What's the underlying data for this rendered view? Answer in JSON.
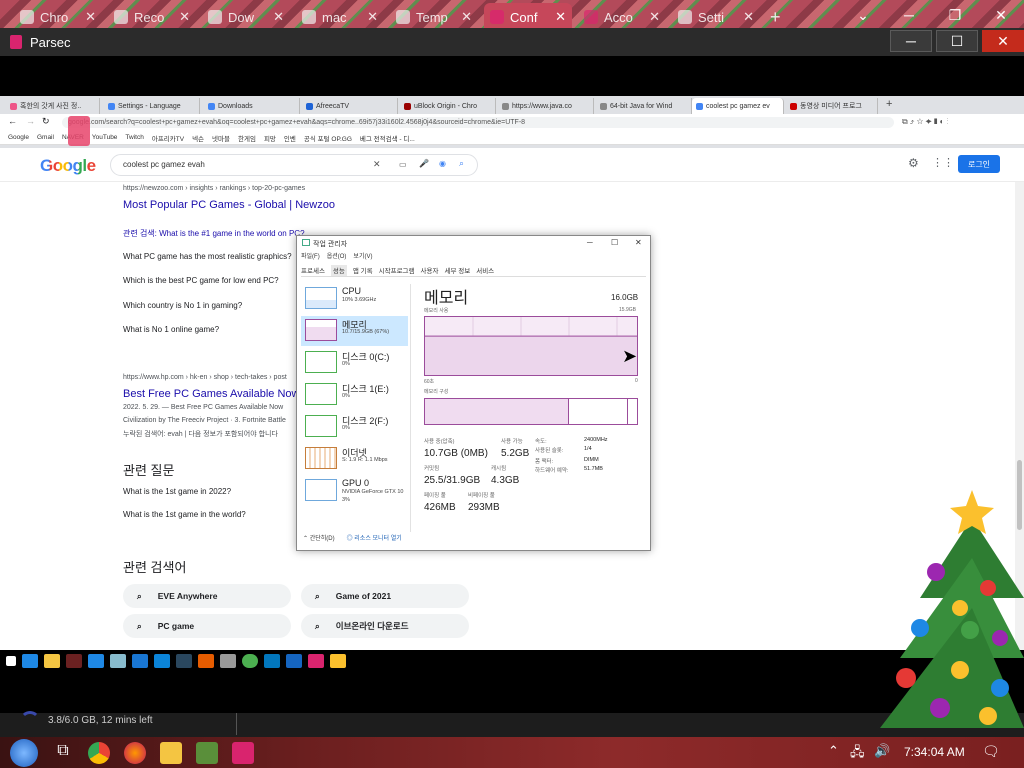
{
  "outer_tabs": [
    {
      "label": "Chro",
      "icon": "chrome-icon"
    },
    {
      "label": "Reco",
      "icon": "google-icon"
    },
    {
      "label": "Dow",
      "icon": "download-icon"
    },
    {
      "label": "mac",
      "icon": "bank-icon"
    },
    {
      "label": "Temp",
      "icon": "page-icon"
    },
    {
      "label": "Conf",
      "icon": "parsec-icon"
    },
    {
      "label": "Acco",
      "icon": "parsec-icon"
    },
    {
      "label": "Setti",
      "icon": "gear-icon"
    }
  ],
  "parsec": {
    "title": "Parsec"
  },
  "inner_tabs": [
    "혹한의 갓게 사진 정..",
    "Settings - Language",
    "Downloads",
    "AfreecaTV",
    "uBlock Origin - Chro",
    "https://www.java.co",
    "64-bit Java for Wind",
    "coolest pc gamez ev",
    "동영상 미디어 프로그"
  ],
  "url": "google.com/search?q=coolest+pc+gamez+evah&oq=coolest+pc+gamez+evah&aqs=chrome..69i57j33i160l2.4568j0j4&sourceid=chrome&ie=UTF-8",
  "bookmarks": [
    "Google",
    "Gmail",
    "NAVER",
    "YouTube",
    "Twitch",
    "아프리카TV",
    "넥슨",
    "넷마블",
    "한게임",
    "피망",
    "인벤",
    "공식 포털 OP.GG",
    "베그 전적검색 - 디..."
  ],
  "search": {
    "logo": "Google",
    "query": "coolest pc gamez evah",
    "login": "로그인"
  },
  "results": {
    "url1": "https://newzoo.com › insights › rankings › top-20-pc-games",
    "title1": "Most Popular PC Games - Global | Newzoo",
    "related": "관련 검색: What is the #1 game in the world on PC?",
    "q1": "What PC game has the most realistic graphics?",
    "q2": "Which is the best PC game for low end PC?",
    "q3": "Which country is No 1 in gaming?",
    "q4": "What is No 1 online game?",
    "url2": "https://www.hp.com › hk-en › shop › tech-takes › post",
    "title2": "Best Free PC Games Available Now",
    "snip1": "2022. 5. 29. — Best Free PC Games Available Now",
    "snip2": "Civilization by The Freeciv Project · 3. Fortnite Battle",
    "snip3": "누락된 검색어: evah | 다음 정보가 포함되어야 합니다",
    "sec1": "관련 질문",
    "rq1": "What is the 1st game in 2022?",
    "rq2": "What is the 1st game in the world?",
    "sec2": "관련 검색어",
    "chips": [
      "EVE Anywhere",
      "Game of 2021",
      "PC game",
      "이브온라인 다운로드"
    ]
  },
  "taskmgr": {
    "title": "작업 관리자",
    "menu": [
      "파일(F)",
      "옵션(O)",
      "보기(V)"
    ],
    "tabs": [
      "프로세스",
      "성능",
      "앱 기록",
      "시작프로그램",
      "사용자",
      "세부 정보",
      "서비스"
    ],
    "side": [
      {
        "name": "CPU",
        "sub": "10% 3.69GHz"
      },
      {
        "name": "메모리",
        "sub": "10.7/15.9GB (67%)"
      },
      {
        "name": "디스크 0(C:)",
        "sub": "0%"
      },
      {
        "name": "디스크 1(E:)",
        "sub": "0%"
      },
      {
        "name": "디스크 2(F:)",
        "sub": "0%"
      },
      {
        "name": "이더넷",
        "sub": "S: 1.9 R: 1.1 Mbps"
      },
      {
        "name": "GPU 0",
        "sub": "NVIDIA GeForce GTX 10",
        "sub2": "3%"
      }
    ],
    "heading": "메모리",
    "total": "16.0GB",
    "graph_label": "메모리 사용",
    "graph_max": "15.9GB",
    "graph_time": "60초",
    "graph_zero": "0",
    "comp_label": "메모리 구성",
    "stats": {
      "inuse_l": "사용 중(압축)",
      "inuse_v": "10.7GB (0MB)",
      "avail_l": "사용 가능",
      "avail_v": "5.2GB",
      "commit_l": "커밋됨",
      "commit_v": "25.5/31.9GB",
      "cache_l": "캐시됨",
      "cache_v": "4.3GB",
      "paged_l": "페이징 풀",
      "paged_v": "426MB",
      "nonpaged_l": "비페이징 풀",
      "nonpaged_v": "293MB",
      "speed_l": "속도:",
      "speed_v": "2400MHz",
      "slots_l": "사용된 슬롯:",
      "slots_v": "1/4",
      "form_l": "폼 팩터:",
      "form_v": "DIMM",
      "hw_l": "하드웨어 예약:",
      "hw_v": "51.7MB"
    },
    "foot1": "간단히(D)",
    "foot2": "리소스 모니터 열기"
  },
  "status": {
    "text": "3.8/6.0 GB, 12 mins left"
  },
  "clock": "7:34:04 AM",
  "memory_usage_fraction": 0.67
}
